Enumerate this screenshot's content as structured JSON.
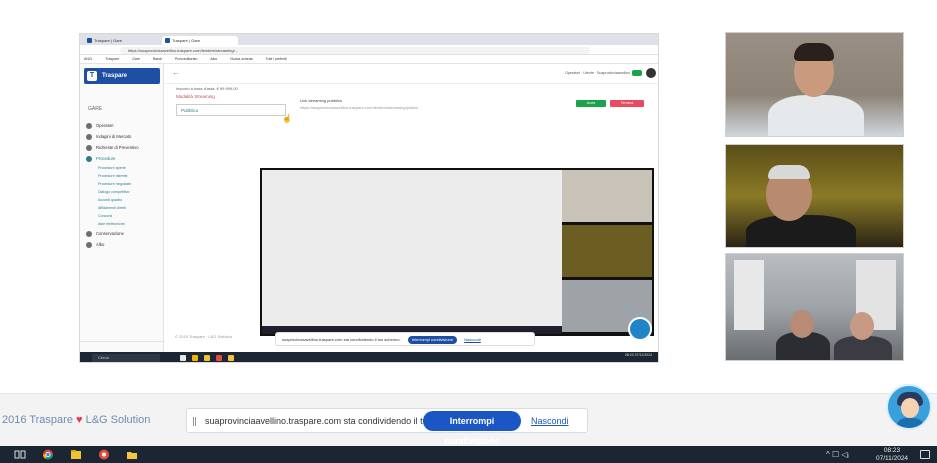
{
  "browser": {
    "tabs": [
      {
        "label": "Traspare | Gare"
      },
      {
        "label": "Traspare | Gare"
      }
    ],
    "url": "https://suaprovinciaavellino.traspare.com/tenders/streaming/...",
    "bookmarks": [
      "ANCI",
      "Traspare",
      "Gare",
      "Bandi",
      "Provveditorato",
      "Albo",
      "Nuova scheda",
      "Tutti i preferiti"
    ]
  },
  "app": {
    "brand": "Traspare",
    "logo_letter": "T",
    "sidebar_header": "GARE",
    "menu": [
      {
        "label": "Operatori"
      },
      {
        "label": "Indagini di Mercato"
      },
      {
        "label": "Richieste di Preventivo"
      },
      {
        "label": "Procedure"
      },
      {
        "label": "Procedure aperte"
      },
      {
        "label": "Procedure ristrette"
      },
      {
        "label": "Procedure negoziate"
      },
      {
        "label": "Dialogo competitivo"
      },
      {
        "label": "Accordi quadro"
      },
      {
        "label": "Affidamenti diretti"
      },
      {
        "label": "Concorsi"
      },
      {
        "label": "Aste elettroniche"
      },
      {
        "label": "Conservazione"
      },
      {
        "label": "Albo"
      }
    ],
    "back_arrow": "←",
    "header_right": "Operatori · Utente · Suaprovinciaavellino",
    "form_label": "Importo a base d'asta: € 99.999,00",
    "streaming_label": "Modalità Streaming",
    "select_value": "Pubblico",
    "link_title": "Link streaming pubblico",
    "link_url": "https://suaprovinciaavellino.traspare.com/tenders/streaming/public/...",
    "btn_start": "Avvia",
    "btn_stop": "Termina",
    "copyright": "© 2016 Traspare · L&G Solution",
    "inner_share_msg": "suaprovinciaavellino.traspare.com sta condividendo il tuo schermo.",
    "inner_stop": "Interrompi condivisione",
    "inner_hide": "Nascondi",
    "search_placeholder": "Cerca",
    "inner_time": "08:23\n07/11/2024"
  },
  "footer": {
    "copyright_prefix": "2016 ",
    "brand_a": "Traspare",
    "heart": "♥",
    "brand_b": "L&G Solution",
    "share_message": "suaprovinciaavellino.traspare.com sta condividendo il tuo schermo.",
    "stop_sharing": "Interrompi condivisione",
    "hide": "Nascondi"
  },
  "taskbar": {
    "tray": "^ ☐ ◁ᵢ",
    "time": "08:23",
    "date": "07/11/2024"
  },
  "colors": {
    "brand_blue": "#1e4fa3",
    "accent_teal": "#2d7d8c",
    "share_button": "#1a56c4",
    "heart": "#e8384f",
    "taskbar": "#1b2632"
  }
}
